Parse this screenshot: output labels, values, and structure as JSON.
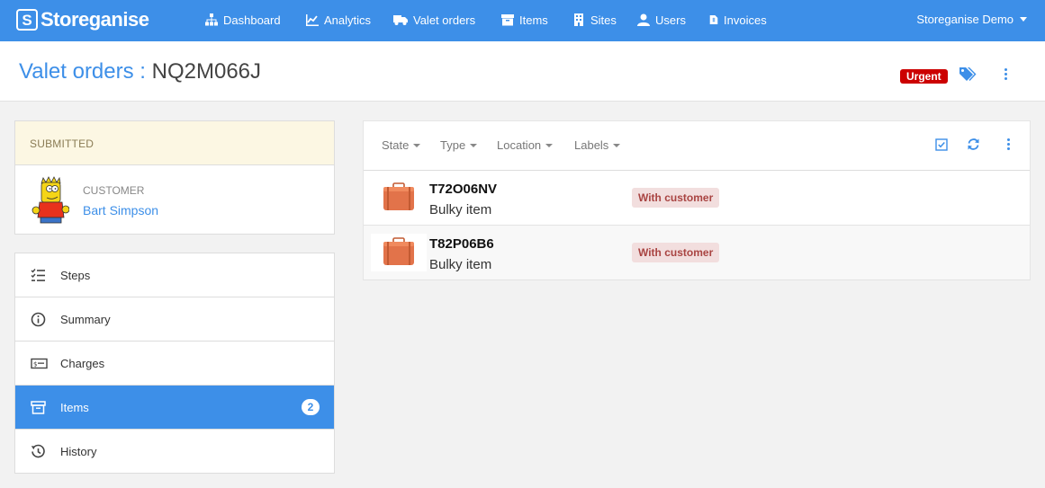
{
  "brand": {
    "logo_letter": "S",
    "name": "Storeganise"
  },
  "nav": {
    "items": [
      {
        "label": "Dashboard",
        "icon": "sitemap-icon"
      },
      {
        "label": "Analytics",
        "icon": "chart-icon"
      },
      {
        "label": "Valet orders",
        "icon": "truck-icon"
      },
      {
        "label": "Items",
        "icon": "box-icon"
      },
      {
        "label": "Sites",
        "icon": "building-icon"
      },
      {
        "label": "Users",
        "icon": "user-icon"
      },
      {
        "label": "Invoices",
        "icon": "invoice-icon"
      }
    ],
    "account": "Storeganise Demo"
  },
  "header": {
    "section": "Valet orders",
    "separator": ":",
    "order_id": "NQ2M066J",
    "urgent_label": "Urgent"
  },
  "order": {
    "status": "SUBMITTED",
    "customer_label": "CUSTOMER",
    "customer_name": "Bart Simpson"
  },
  "sidebar": {
    "items": [
      {
        "label": "Steps",
        "icon": "checklist-icon"
      },
      {
        "label": "Summary",
        "icon": "info-icon"
      },
      {
        "label": "Charges",
        "icon": "money-icon"
      },
      {
        "label": "Items",
        "icon": "archive-icon",
        "count": "2",
        "active": true
      },
      {
        "label": "History",
        "icon": "history-icon"
      }
    ]
  },
  "filters": [
    "State",
    "Type",
    "Location",
    "Labels"
  ],
  "items": [
    {
      "code": "T72O06NV",
      "kind": "Bulky item",
      "state": "With customer"
    },
    {
      "code": "T82P06B6",
      "kind": "Bulky item",
      "state": "With customer"
    }
  ],
  "colors": {
    "accent": "#3d8fe8",
    "urgent": "#cc0000",
    "state_bg": "#f2dede",
    "state_text": "#a94442",
    "status_bg": "#fcf7e3"
  }
}
